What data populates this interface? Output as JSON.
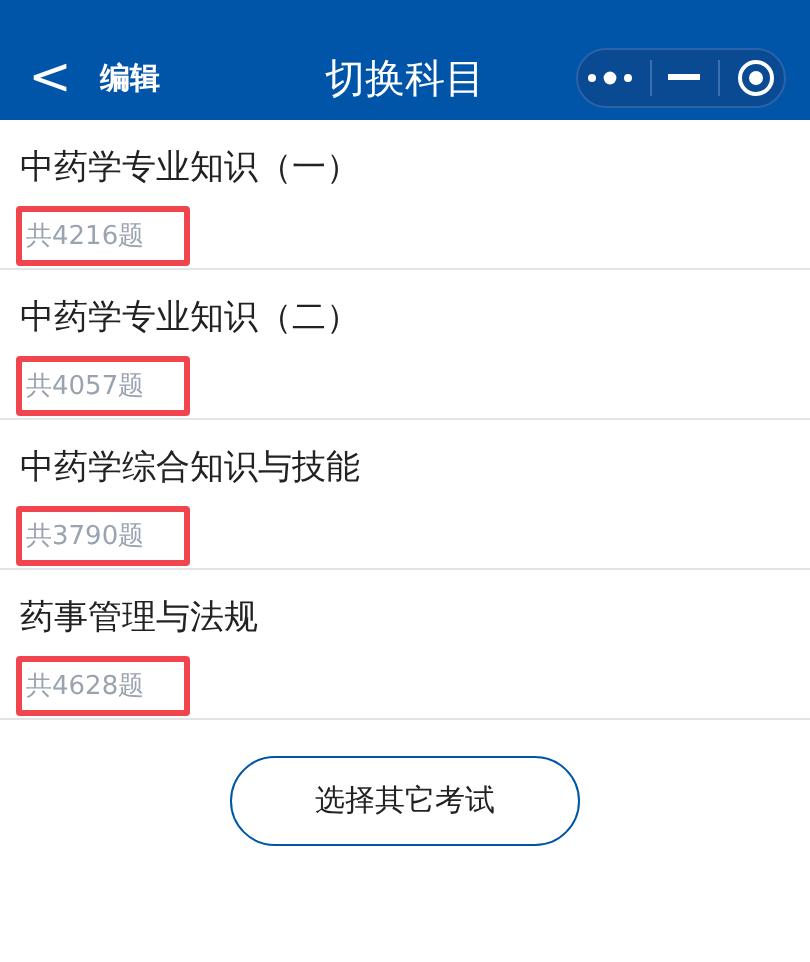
{
  "nav_bar": {
    "back": "<",
    "edit": "编辑",
    "title": "切换科目"
  },
  "subjects": [
    {
      "title": "中药学专业知识（一）",
      "count": "共4216题",
      "highlighted": true
    },
    {
      "title": "中药学专业知识（二）",
      "count": "共4057题",
      "highlighted": true
    },
    {
      "title": "中药学综合知识与技能",
      "count": "共3790题",
      "highlighted": true
    },
    {
      "title": "药事管理与法规",
      "count": "共4628题",
      "highlighted": true
    }
  ],
  "other_exam_button": "选择其它考试"
}
